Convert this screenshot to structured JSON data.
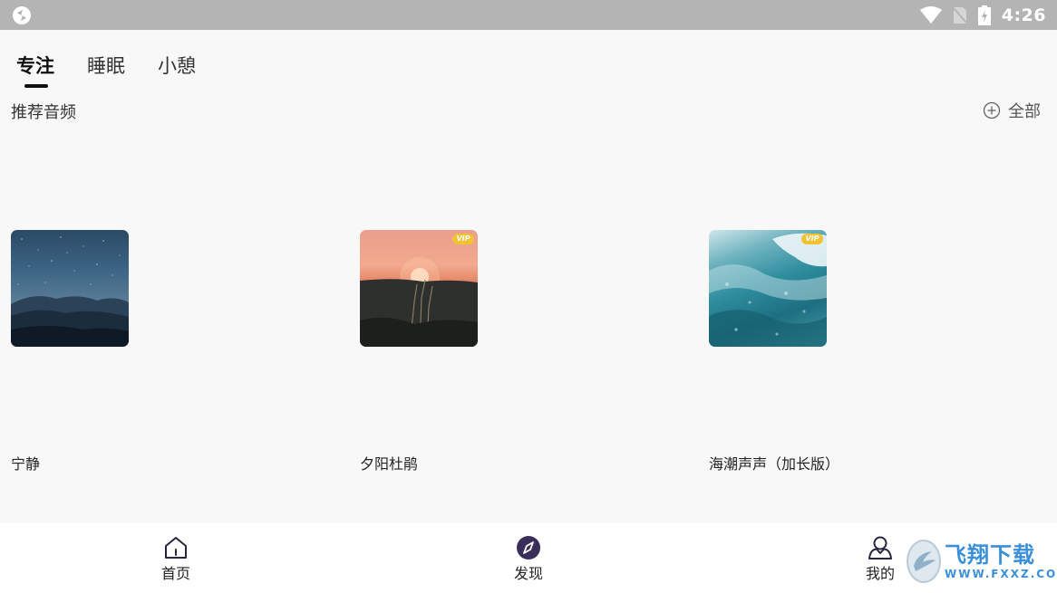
{
  "status_bar": {
    "time": "4:26",
    "icons": [
      "wifi-icon",
      "sim-icon",
      "battery-icon"
    ]
  },
  "tabs": [
    {
      "label": "专注",
      "active": true
    },
    {
      "label": "睡眠",
      "active": false
    },
    {
      "label": "小憩",
      "active": false
    }
  ],
  "section": {
    "title": "推荐音频",
    "all_label": "全部"
  },
  "cards": [
    {
      "title": "宁静",
      "vip": false
    },
    {
      "title": "夕阳杜鹃",
      "vip": true,
      "badge": "VIP"
    },
    {
      "title": "海潮声声（加长版）",
      "vip": true,
      "badge": "VIP"
    }
  ],
  "bottom_nav": [
    {
      "label": "首页",
      "icon": "home-icon"
    },
    {
      "label": "发现",
      "icon": "compass-icon"
    },
    {
      "label": "我的",
      "icon": "user-icon"
    }
  ],
  "watermark": {
    "main": "飞翔下载",
    "sub": "WWW.FXXZ.COM"
  }
}
